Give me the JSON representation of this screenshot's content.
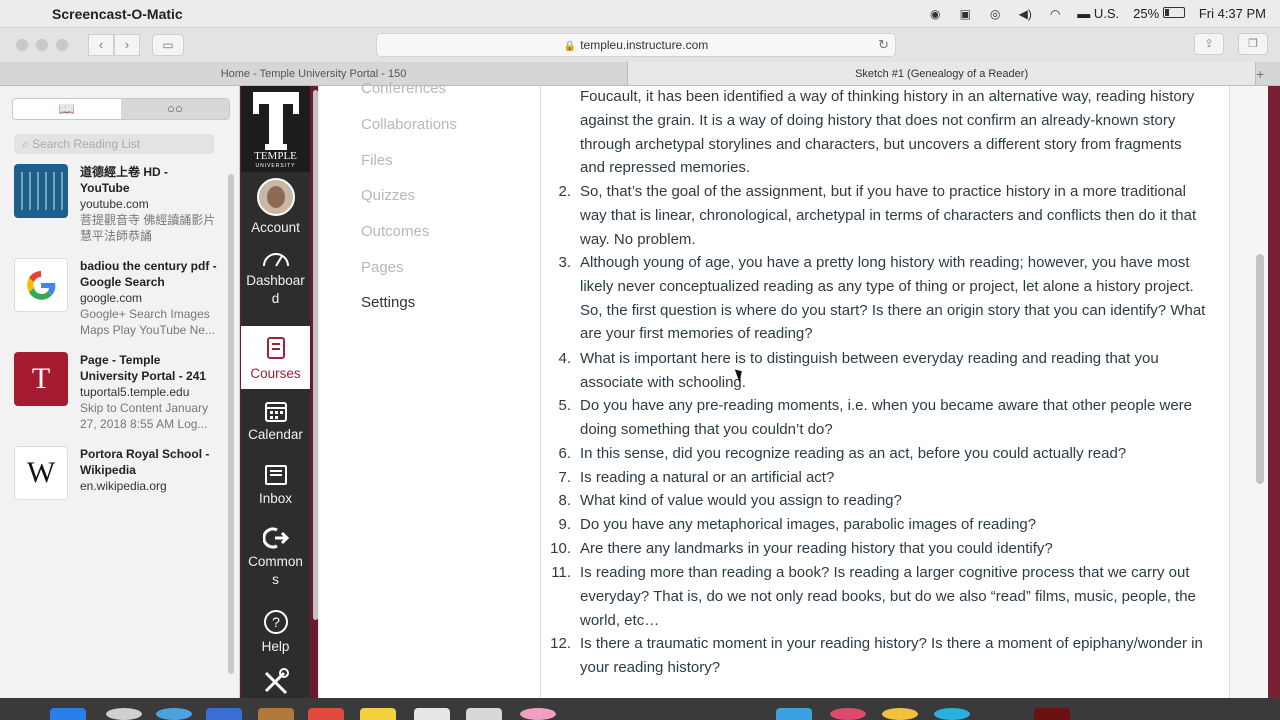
{
  "menubar": {
    "app_name": "Screencast-O-Matic",
    "input_source": "U.S.",
    "battery": "25%",
    "clock": "Fri 4:37 PM"
  },
  "toolbar": {
    "url": "templeu.instructure.com"
  },
  "tabs": [
    {
      "label": "Home - Temple University Portal - 150"
    },
    {
      "label": "Sketch #1 (Genealogy of a Reader)"
    }
  ],
  "reading_list": {
    "search_placeholder": "Search Reading List",
    "items": [
      {
        "title": "道德經上卷 HD - YouTube",
        "host": "youtube.com",
        "desc": "菩提觀音寺 佛經讀誦影片 慧平法師恭誦",
        "thumb_color": "#1d5f8a",
        "thumb_icon": "calligraphy-thumbnail"
      },
      {
        "title": "badiou the century pdf - Google Search",
        "host": "google.com",
        "desc": "Google+ Search Images Maps Play YouTube Ne...",
        "thumb_color": "#ffffff",
        "thumb_icon": "google-g-icon"
      },
      {
        "title": "Page - Temple University Portal - 241",
        "host": "tuportal5.temple.edu",
        "desc": "Skip to Content January 27, 2018 8:55 AM Log...",
        "thumb_color": "#a51c30",
        "thumb_icon": "temple-t-icon"
      },
      {
        "title": "Portora Royal School - Wikipedia",
        "host": "en.wikipedia.org",
        "desc": "",
        "thumb_color": "#ffffff",
        "thumb_icon": "wikipedia-w-icon"
      }
    ]
  },
  "global_nav": {
    "logo_text": "TEMPLE",
    "logo_subtext": "UNIVERSITY",
    "items": [
      {
        "label": "Account",
        "icon": "avatar"
      },
      {
        "label": "Dashboard",
        "icon": "dashboard-icon"
      },
      {
        "label": "Courses",
        "icon": "courses-icon"
      },
      {
        "label": "Calendar",
        "icon": "calendar-icon"
      },
      {
        "label": "Inbox",
        "icon": "inbox-icon"
      },
      {
        "label": "Commons",
        "icon": "commons-icon"
      },
      {
        "label": "Help",
        "icon": "help-icon"
      },
      {
        "label": "",
        "icon": "tools-icon"
      }
    ]
  },
  "course_nav": {
    "items": [
      {
        "label": "Conferences"
      },
      {
        "label": "Collaborations"
      },
      {
        "label": "Files"
      },
      {
        "label": "Quizzes"
      },
      {
        "label": "Outcomes"
      },
      {
        "label": "Pages"
      },
      {
        "label": "Settings"
      }
    ]
  },
  "content": {
    "intro": "Foucault, it has been identified a way of thinking history in an alternative way, reading history against the grain. It is a way of doing history that does not confirm an already-known story through archetypal storylines and characters, but uncovers a different story from fragments and repressed memories.",
    "list": [
      {
        "num": "2.",
        "text": "So, that’s the goal of the assignment, but if you have to practice history in a more traditional way that is linear, chronological, archetypal in terms of characters and conflicts then do it that way. No problem."
      },
      {
        "num": "3.",
        "text": "Although young of age, you have a pretty long history with reading; however, you have most likely never conceptualized reading as any type of thing or project, let alone a history project. So, the first question is where do you start? Is there an origin story that you can identify? What are your first memories of reading?"
      },
      {
        "num": "4.",
        "text": "What is important here is to distinguish between everyday reading and reading that you associate with schooling."
      },
      {
        "num": "5.",
        "text": "Do you have any pre-reading moments, i.e. when you became aware that other people were doing something that you couldn’t do?"
      },
      {
        "num": "6.",
        "text": "In this sense, did you recognize reading as an act, before you could actually read?"
      },
      {
        "num": "7.",
        "text": "Is reading a natural or an artificial act?"
      },
      {
        "num": "8.",
        "text": "What kind of value would you assign to reading?"
      },
      {
        "num": "9.",
        "text": "Do you have any metaphorical images, parabolic images of reading?"
      },
      {
        "num": "10.",
        "text": "Are there any landmarks in your reading history that you could identify?"
      },
      {
        "num": "11.",
        "text": "Is reading more than reading a book? Is reading a larger cognitive process that we carry out everyday? That is, do we not only read books, but do we also “read” films, music, people, the world, etc…"
      },
      {
        "num": "12.",
        "text": "Is there a traumatic moment in your reading history? Is there a moment of epiphany/wonder in your reading history?"
      }
    ]
  }
}
